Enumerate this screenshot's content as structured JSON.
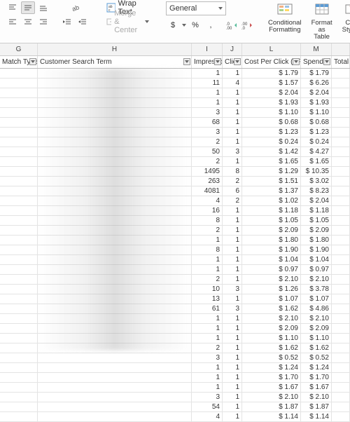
{
  "ribbon": {
    "wrap_text": "Wrap Text",
    "merge_center": "Merge & Center",
    "number_format": "General",
    "currency": "$",
    "percent": "%",
    "comma": ",",
    "inc_dec_labels": [
      ".0",
      ".00"
    ],
    "cond_fmt_l1": "Conditional",
    "cond_fmt_l2": "Formatting",
    "fmt_table_l1": "Format",
    "fmt_table_l2": "as Table",
    "cell_styles_l1": "Cell",
    "cell_styles_l2": "Styles"
  },
  "columns": {
    "letters": [
      "G",
      "H",
      "I",
      "J",
      "L",
      "M",
      ""
    ],
    "headers": {
      "g": "Match Type",
      "h": "Customer Search Term",
      "i": "Impressions",
      "j": "Click",
      "l": "Cost Per Click (CPC)",
      "m": "Spend",
      "n": "Total A"
    }
  },
  "rows": [
    {
      "i": 1,
      "j": 1,
      "l": "$ 1.79",
      "m": "$ 1.79"
    },
    {
      "i": 11,
      "j": 4,
      "l": "$ 1.57",
      "m": "$ 6.26"
    },
    {
      "i": 1,
      "j": 1,
      "l": "$ 2.04",
      "m": "$ 2.04"
    },
    {
      "i": 1,
      "j": 1,
      "l": "$ 1.93",
      "m": "$ 1.93"
    },
    {
      "i": 3,
      "j": 1,
      "l": "$ 1.10",
      "m": "$ 1.10"
    },
    {
      "i": 68,
      "j": 1,
      "l": "$ 0.68",
      "m": "$ 0.68"
    },
    {
      "i": 3,
      "j": 1,
      "l": "$ 1.23",
      "m": "$ 1.23"
    },
    {
      "i": 2,
      "j": 1,
      "l": "$ 0.24",
      "m": "$ 0.24"
    },
    {
      "i": 50,
      "j": 3,
      "l": "$ 1.42",
      "m": "$ 4.27"
    },
    {
      "i": 2,
      "j": 1,
      "l": "$ 1.65",
      "m": "$ 1.65"
    },
    {
      "i": 1495,
      "j": 8,
      "l": "$ 1.29",
      "m": "$ 10.35"
    },
    {
      "i": 263,
      "j": 2,
      "l": "$ 1.51",
      "m": "$ 3.02"
    },
    {
      "i": 4081,
      "j": 6,
      "l": "$ 1.37",
      "m": "$ 8.23"
    },
    {
      "i": 4,
      "j": 2,
      "l": "$ 1.02",
      "m": "$ 2.04"
    },
    {
      "i": 16,
      "j": 1,
      "l": "$ 1.18",
      "m": "$ 1.18"
    },
    {
      "i": 8,
      "j": 1,
      "l": "$ 1.05",
      "m": "$ 1.05"
    },
    {
      "i": 2,
      "j": 1,
      "l": "$ 2.09",
      "m": "$ 2.09"
    },
    {
      "i": 1,
      "j": 1,
      "l": "$ 1.80",
      "m": "$ 1.80"
    },
    {
      "i": 8,
      "j": 1,
      "l": "$ 1.90",
      "m": "$ 1.90"
    },
    {
      "i": 1,
      "j": 1,
      "l": "$ 1.04",
      "m": "$ 1.04"
    },
    {
      "i": 1,
      "j": 1,
      "l": "$ 0.97",
      "m": "$ 0.97"
    },
    {
      "i": 2,
      "j": 1,
      "l": "$ 2.10",
      "m": "$ 2.10"
    },
    {
      "i": 10,
      "j": 3,
      "l": "$ 1.26",
      "m": "$ 3.78"
    },
    {
      "i": 13,
      "j": 1,
      "l": "$ 1.07",
      "m": "$ 1.07"
    },
    {
      "i": 61,
      "j": 3,
      "l": "$ 1.62",
      "m": "$ 4.86"
    },
    {
      "i": 1,
      "j": 1,
      "l": "$ 2.10",
      "m": "$ 2.10"
    },
    {
      "i": 1,
      "j": 1,
      "l": "$ 2.09",
      "m": "$ 2.09"
    },
    {
      "i": 1,
      "j": 1,
      "l": "$ 1.10",
      "m": "$ 1.10"
    },
    {
      "i": 2,
      "j": 1,
      "l": "$ 1.62",
      "m": "$ 1.62"
    },
    {
      "i": 3,
      "j": 1,
      "l": "$ 0.52",
      "m": "$ 0.52"
    },
    {
      "i": 1,
      "j": 1,
      "l": "$ 1.24",
      "m": "$ 1.24"
    },
    {
      "i": 1,
      "j": 1,
      "l": "$ 1.70",
      "m": "$ 1.70"
    },
    {
      "i": 1,
      "j": 1,
      "l": "$ 1.67",
      "m": "$ 1.67"
    },
    {
      "i": 3,
      "j": 1,
      "l": "$ 2.10",
      "m": "$ 2.10"
    },
    {
      "i": 54,
      "j": 1,
      "l": "$ 1.87",
      "m": "$ 1.87"
    },
    {
      "i": 4,
      "j": 1,
      "l": "$ 1.14",
      "m": "$ 1.14"
    }
  ]
}
